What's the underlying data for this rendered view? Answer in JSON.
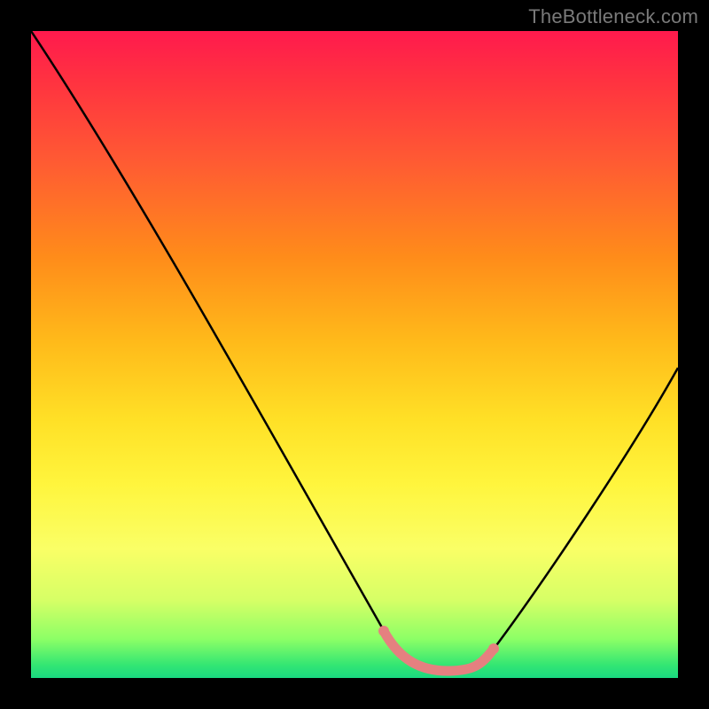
{
  "watermark": "TheBottleneck.com",
  "colors": {
    "background": "#000000",
    "curve_stroke": "#000000",
    "highlight_stroke": "#e58080",
    "gradient_stops": [
      "#ff1a4d",
      "#ff3340",
      "#ff5a33",
      "#ff8c1a",
      "#ffba1a",
      "#ffe026",
      "#fff53d",
      "#faff66",
      "#d6ff66",
      "#8cff66",
      "#33e673",
      "#1ad980"
    ]
  },
  "chart_data": {
    "type": "line",
    "title": "",
    "xlabel": "",
    "ylabel": "",
    "xlim": [
      0,
      100
    ],
    "ylim": [
      0,
      100
    ],
    "x": [
      0,
      5,
      10,
      15,
      20,
      25,
      30,
      35,
      40,
      45,
      50,
      55,
      58,
      60,
      62,
      65,
      68,
      70,
      72,
      75,
      80,
      85,
      90,
      95,
      100
    ],
    "values": [
      100,
      92,
      84,
      76,
      68,
      60,
      52,
      44,
      36,
      28,
      20,
      12,
      6,
      2,
      1,
      0.5,
      0.5,
      1,
      2,
      5,
      12,
      20,
      29,
      38,
      47
    ],
    "highlight_range_x": [
      55,
      72
    ],
    "annotations": []
  }
}
